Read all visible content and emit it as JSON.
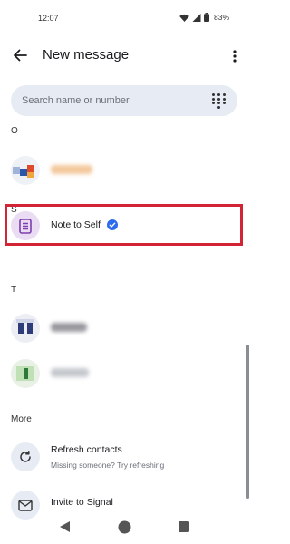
{
  "status_bar": {
    "time": "12:07",
    "battery": "83%"
  },
  "header": {
    "title": "New message"
  },
  "search": {
    "placeholder": "Search name or number"
  },
  "sections": {
    "o": "O",
    "s": "S",
    "t": "T",
    "more": "More"
  },
  "contacts": {
    "note_to_self": {
      "name": "Note to Self",
      "verified_color": "#2c6bed"
    }
  },
  "more_items": [
    {
      "title": "Refresh contacts",
      "subtitle": "Missing someone? Try refreshing",
      "icon": "refresh-icon"
    },
    {
      "title": "Invite to Signal",
      "icon": "mail-icon"
    }
  ],
  "colors": {
    "highlight": "#d32436",
    "surface": "#e7ebf3",
    "avatar_note": "#e9dcf3"
  }
}
